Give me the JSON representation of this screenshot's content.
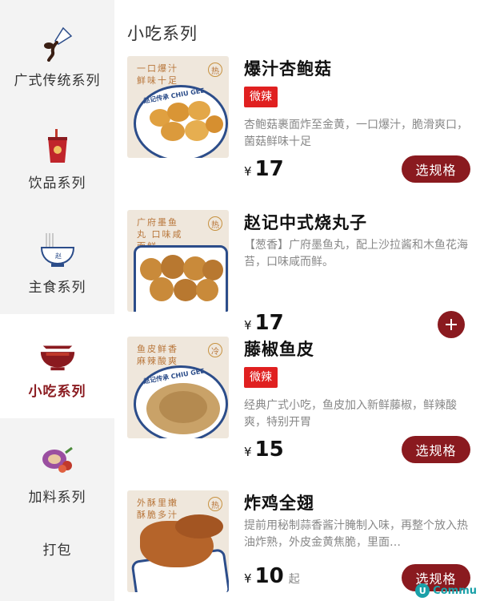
{
  "sidebar": {
    "items": [
      {
        "label": "广式传统系列",
        "icon": "sauce-pour-icon"
      },
      {
        "label": "饮品系列",
        "icon": "drink-cup-icon"
      },
      {
        "label": "主食系列",
        "icon": "noodle-bowl-icon"
      },
      {
        "label": "小吃系列",
        "icon": "snack-bowl-icon",
        "active": true
      },
      {
        "label": "加料系列",
        "icon": "ingredients-icon"
      },
      {
        "label": "打包",
        "icon": ""
      }
    ]
  },
  "main": {
    "section_title": "小吃系列",
    "items": [
      {
        "name": "爆汁杏鲍菇",
        "tag": "微辣",
        "desc": "杏鲍菇裹面炸至金黄，一口爆汁，脆滑爽口，菌菇鲜味十足",
        "currency": "¥",
        "price": "17",
        "action": "选规格",
        "img_tagline": "一口爆汁 鲜味十足",
        "img_badge": "热",
        "img_brand": "赵记传承 CHIU GEE"
      },
      {
        "name": "赵记中式烧丸子",
        "tag": "",
        "desc": "【葱香】广府墨鱼丸，配上沙拉酱和木鱼花海苔，口味咸而鲜。",
        "currency": "¥",
        "price": "17",
        "action": "+",
        "img_tagline": "广府墨鱼丸 口味咸而鲜",
        "img_badge": "热",
        "img_brand": ""
      },
      {
        "name": "藤椒鱼皮",
        "tag": "微辣",
        "desc": "经典广式小吃，鱼皮加入新鲜藤椒，鲜辣酸爽，特别开胃",
        "currency": "¥",
        "price": "15",
        "action": "选规格",
        "img_tagline": "鱼皮鲜香 麻辣酸爽",
        "img_badge": "冷",
        "img_brand": "赵记传承 CHIU GEE"
      },
      {
        "name": "炸鸡全翅",
        "tag": "",
        "desc": "提前用秘制蒜香酱汁腌制入味，再整个放入热油炸熟，外皮金黄焦脆，里面…",
        "currency": "¥",
        "price": "10",
        "price_suffix": "起",
        "action": "选规格",
        "img_tagline": "外酥里嫩 酥脆多汁",
        "img_badge": "热",
        "img_brand": ""
      }
    ]
  },
  "watermark": {
    "text": "Commu",
    "logo": "U"
  },
  "colors": {
    "accent": "#8a1a1f",
    "spicy": "#e02020",
    "sidebar_bg": "#f3f3f3"
  }
}
